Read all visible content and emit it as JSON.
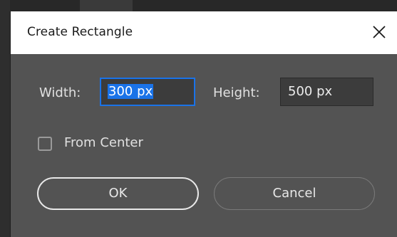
{
  "dialog": {
    "title": "Create Rectangle",
    "close_icon": "close-icon"
  },
  "fields": {
    "width_label": "Width:",
    "width_value": "300 px",
    "height_label": "Height:",
    "height_value": "500 px"
  },
  "options": {
    "from_center_label": "From Center",
    "from_center_checked": false
  },
  "buttons": {
    "ok_label": "OK",
    "cancel_label": "Cancel"
  },
  "colors": {
    "dialog_bg": "#535353",
    "titlebar_bg": "#ffffff",
    "field_bg": "#3c3c3c",
    "focus_accent": "#1a73e8"
  }
}
